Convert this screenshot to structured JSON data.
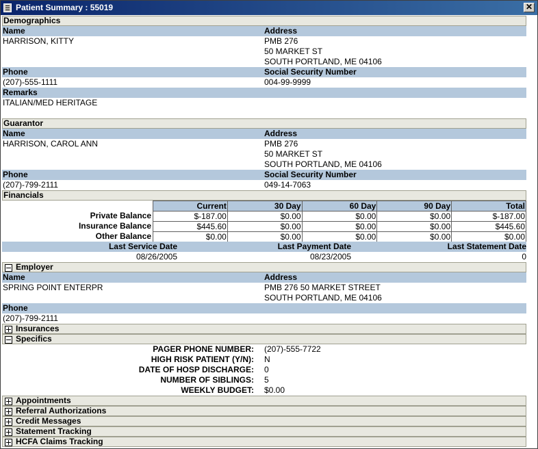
{
  "window": {
    "title": "Patient Summary : 55019",
    "close": "✕"
  },
  "demographics": {
    "section": "Demographics",
    "name_label": "Name",
    "address_label": "Address",
    "name": "HARRISON, KITTY",
    "address1": "PMB 276",
    "address2": "50 MARKET ST",
    "address3": "SOUTH PORTLAND, ME 04106",
    "phone_label": "Phone",
    "ssn_label": "Social Security Number",
    "phone": "(207)-555-1111",
    "ssn": "004-99-9999",
    "remarks_label": "Remarks",
    "remarks": "ITALIAN/MED HERITAGE"
  },
  "guarantor": {
    "section": "Guarantor",
    "name_label": "Name",
    "address_label": "Address",
    "name": "HARRISON, CAROL ANN",
    "address1": "PMB 276",
    "address2": "50 MARKET ST",
    "address3": "SOUTH PORTLAND, ME 04106",
    "phone_label": "Phone",
    "ssn_label": "Social Security Number",
    "phone": "(207)-799-2111",
    "ssn": "049-14-7063"
  },
  "financials": {
    "section": "Financials",
    "columns": [
      "Current",
      "30 Day",
      "60 Day",
      "90 Day",
      "Total"
    ],
    "rows": [
      {
        "label": "Private Balance",
        "values": [
          "$-187.00",
          "$0.00",
          "$0.00",
          "$0.00",
          "$-187.00"
        ]
      },
      {
        "label": "Insurance Balance",
        "values": [
          "$445.60",
          "$0.00",
          "$0.00",
          "$0.00",
          "$445.60"
        ]
      },
      {
        "label": "Other Balance",
        "values": [
          "$0.00",
          "$0.00",
          "$0.00",
          "$0.00",
          "$0.00"
        ]
      }
    ],
    "last_service_label": "Last Service Date",
    "last_service": "08/26/2005",
    "last_payment_label": "Last Payment Date",
    "last_payment": "08/23/2005",
    "last_statement_label": "Last Statement Date",
    "last_statement": "0"
  },
  "employer": {
    "section": "Employer",
    "name_label": "Name",
    "address_label": "Address",
    "name": "SPRING POINT ENTERPR",
    "address1": "PMB 276 50 MARKET STREET",
    "address2": "SOUTH PORTLAND, ME 04106",
    "phone_label": "Phone",
    "phone": "(207)-799-2111"
  },
  "insurances": {
    "section": "Insurances"
  },
  "specifics": {
    "section": "Specifics",
    "items": [
      {
        "label": "PAGER PHONE NUMBER:",
        "value": "(207)-555-7722"
      },
      {
        "label": "HIGH RISK PATIENT (Y/N):",
        "value": "N"
      },
      {
        "label": "DATE OF HOSP DISCHARGE:",
        "value": "0"
      },
      {
        "label": "NUMBER OF SIBLINGS:",
        "value": "5"
      },
      {
        "label": "WEEKLY BUDGET:",
        "value": "$0.00"
      }
    ]
  },
  "collapsed": [
    "Appointments",
    "Referral Authorizations",
    "Credit Messages",
    "Statement Tracking",
    "HCFA Claims Tracking"
  ]
}
